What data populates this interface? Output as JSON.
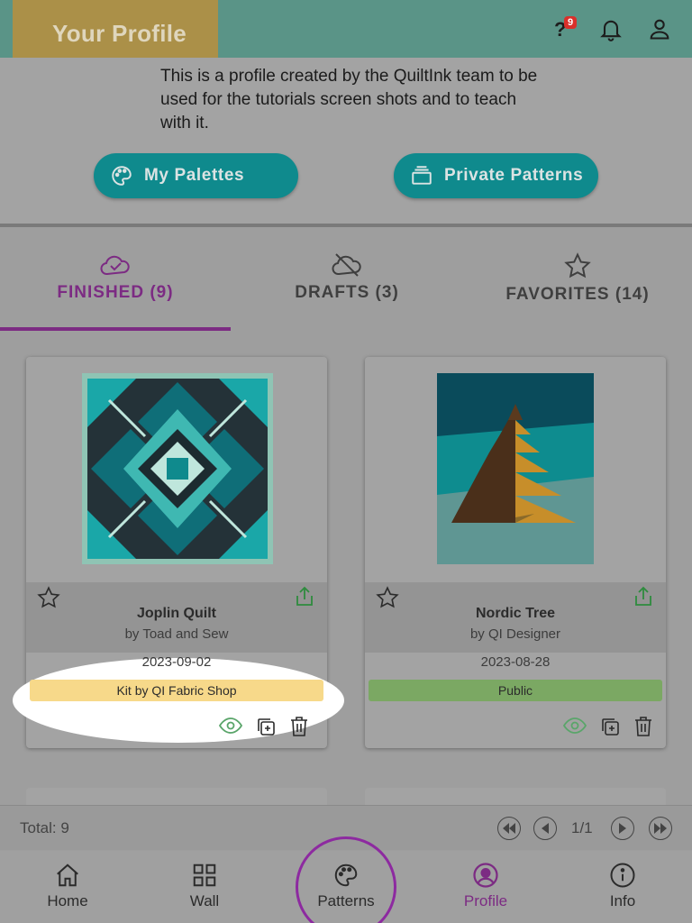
{
  "header": {
    "title": "Your Profile",
    "help_badge_count": "9",
    "icons": [
      "help-icon",
      "bell-icon",
      "person-icon"
    ]
  },
  "profile": {
    "description": "This is a profile created by the QuiltInk team to be used for the tutorials screen shots and to teach with it.",
    "my_palettes_label": "My Palettes",
    "private_patterns_label": "Private Patterns"
  },
  "tabs": [
    {
      "label": "FINISHED (9)",
      "icon": "cloud-check-icon",
      "active": true
    },
    {
      "label": "DRAFTS (3)",
      "icon": "cloud-off-icon",
      "active": false
    },
    {
      "label": "FAVORITES (14)",
      "icon": "star-icon",
      "active": false
    }
  ],
  "cards": [
    {
      "title": "Joplin Quilt",
      "author": "by Toad and Sew",
      "date": "2023-09-02",
      "badge": "Kit by QI Fabric Shop",
      "badge_color": "#f7d98a"
    },
    {
      "title": "Nordic Tree",
      "author": "by QI Designer",
      "date": "2023-08-28",
      "badge": "Public",
      "badge_color": "#7ba863"
    }
  ],
  "pager": {
    "total": "Total: 9",
    "page": "1/1"
  },
  "nav": [
    {
      "label": "Home",
      "icon": "home-icon"
    },
    {
      "label": "Wall",
      "icon": "grid-icon"
    },
    {
      "label": "Patterns",
      "icon": "palette-icon"
    },
    {
      "label": "Profile",
      "icon": "profile-icon",
      "active": true
    },
    {
      "label": "Info",
      "icon": "info-icon"
    }
  ],
  "colors": {
    "teal": "#0f8a8d",
    "purple": "#7c2b83",
    "header": "#5a9487"
  }
}
